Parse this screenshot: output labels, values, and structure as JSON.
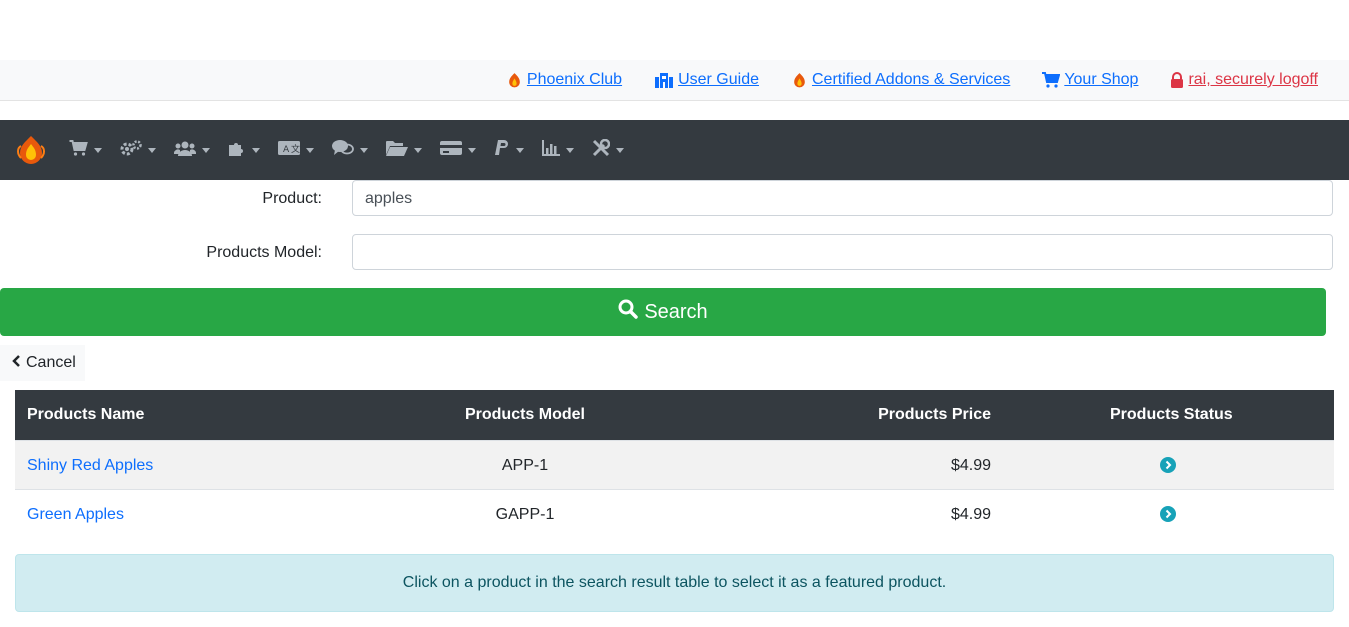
{
  "top_links": [
    {
      "label": "Phoenix Club",
      "icon": "phoenix-icon"
    },
    {
      "label": "User Guide",
      "icon": "building-icon"
    },
    {
      "label": "Certified Addons & Services",
      "icon": "phoenix-icon"
    },
    {
      "label": "Your Shop",
      "icon": "cart-icon"
    },
    {
      "label": "rai, securely logoff",
      "icon": "lock-icon"
    }
  ],
  "colors": {
    "nav_bg": "#343a40",
    "link": "#0d6efd",
    "logoff": "#dc3545",
    "search_button": "#28a745",
    "alert_bg": "#d1ecf1",
    "status_icon": "#17a2b8"
  },
  "nav_menus": [
    "cart-icon",
    "cogs-icon",
    "users-icon",
    "puzzle-icon",
    "language-icon",
    "comments-icon",
    "folder-icon",
    "credit-card-icon",
    "paypal-icon",
    "chart-icon",
    "tools-icon"
  ],
  "form": {
    "product_label": "Product:",
    "product_value": "apples",
    "model_label": "Products Model:",
    "model_value": ""
  },
  "buttons": {
    "search": "Search",
    "cancel": "Cancel"
  },
  "table": {
    "headers": [
      "Products Name",
      "Products Model",
      "Products Price",
      "Products Status"
    ],
    "rows": [
      {
        "name": "Shiny Red Apples",
        "model": "APP-1",
        "price": "$4.99",
        "status": "status-arrow-icon"
      },
      {
        "name": "Green Apples",
        "model": "GAPP-1",
        "price": "$4.99",
        "status": "status-arrow-icon"
      }
    ]
  },
  "alert": "Click on a product in the search result table to select it as a featured product."
}
